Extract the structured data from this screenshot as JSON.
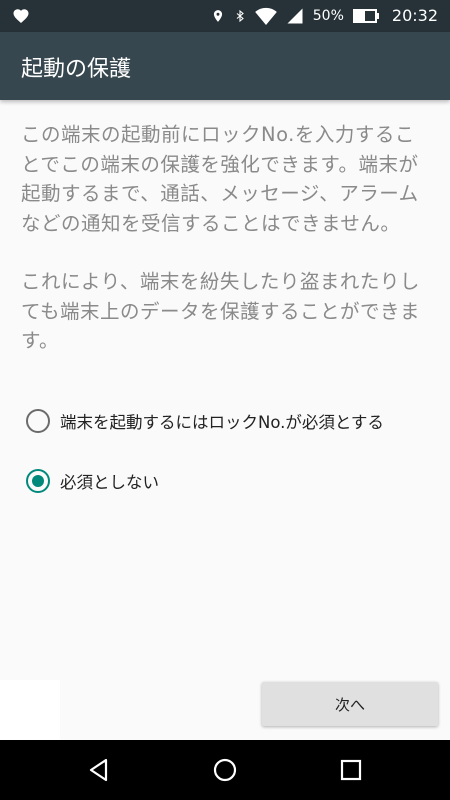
{
  "status_bar": {
    "battery_percent": "50%",
    "time": "20:32",
    "icons": [
      "heart-icon",
      "location-icon",
      "bluetooth-icon",
      "wifi-icon",
      "signal-icon",
      "battery-icon"
    ],
    "battery_level": 0.5
  },
  "toolbar": {
    "title": "起動の保護"
  },
  "description": {
    "paragraph1": "この端末の起動前にロックNo.を入力することでこの端末の保護を強化できます。端末が起動するまで、通話、メッセージ、アラームなどの通知を受信することはできません。",
    "paragraph2": "これにより、端末を紛失したり盗まれたりしても端末上のデータを保護することができます。"
  },
  "options": [
    {
      "label": "端末を起動するにはロックNo.が必須とする",
      "checked": false
    },
    {
      "label": "必須としない",
      "checked": true
    }
  ],
  "actions": {
    "next_label": "次へ"
  },
  "nav": {
    "buttons": [
      "back-icon",
      "home-icon",
      "recents-icon"
    ]
  },
  "colors": {
    "status_bar": "#263238",
    "toolbar": "#37474f",
    "accent": "#00897b",
    "background": "#fafafa"
  }
}
